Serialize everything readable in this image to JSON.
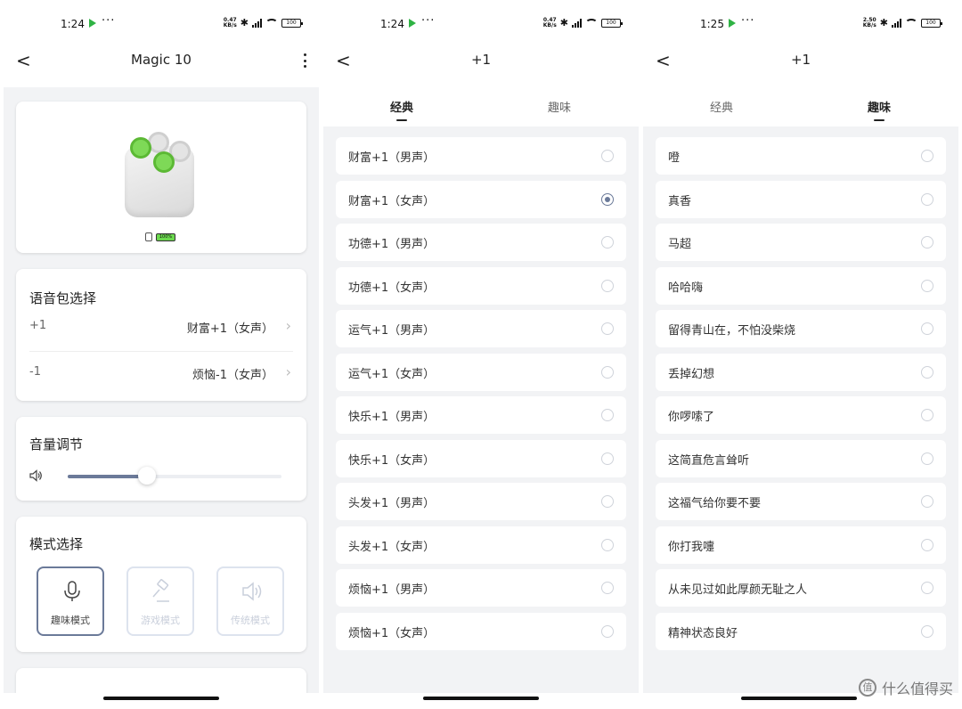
{
  "screen1": {
    "status": {
      "time": "1:24",
      "kbs_top": "0.47",
      "kbs_bottom": "KB/s",
      "battery": "100"
    },
    "nav": {
      "back": "<",
      "title": "Magic 10"
    },
    "device": {
      "battery_pct": "100%"
    },
    "voice_pack": {
      "title": "语音包选择",
      "rows": [
        {
          "key": "+1",
          "value": "财富+1（女声）"
        },
        {
          "key": "-1",
          "value": "烦恼-1（女声）"
        }
      ]
    },
    "volume": {
      "title": "音量调节",
      "level": 0.37
    },
    "mode": {
      "title": "模式选择",
      "modes": [
        {
          "label": "趣味模式",
          "active": true
        },
        {
          "label": "游戏模式",
          "active": false
        },
        {
          "label": "传统模式",
          "active": false
        }
      ]
    }
  },
  "screen2": {
    "status": {
      "time": "1:24",
      "kbs_top": "0.47",
      "kbs_bottom": "KB/s",
      "battery": "100"
    },
    "nav": {
      "back": "<",
      "title": "+1"
    },
    "tabs": [
      "经典",
      "趣味"
    ],
    "active_tab": 0,
    "items": [
      {
        "label": "财富+1（男声）",
        "selected": false
      },
      {
        "label": "财富+1（女声）",
        "selected": true
      },
      {
        "label": "功德+1（男声）",
        "selected": false
      },
      {
        "label": "功德+1（女声）",
        "selected": false
      },
      {
        "label": "运气+1（男声）",
        "selected": false
      },
      {
        "label": "运气+1（女声）",
        "selected": false
      },
      {
        "label": "快乐+1（男声）",
        "selected": false
      },
      {
        "label": "快乐+1（女声）",
        "selected": false
      },
      {
        "label": "头发+1（男声）",
        "selected": false
      },
      {
        "label": "头发+1（女声）",
        "selected": false
      },
      {
        "label": "烦恼+1（男声）",
        "selected": false
      },
      {
        "label": "烦恼+1（女声）",
        "selected": false
      }
    ]
  },
  "screen3": {
    "status": {
      "time": "1:25",
      "kbs_top": "2.50",
      "kbs_bottom": "KB/s",
      "battery": "100"
    },
    "nav": {
      "back": "<",
      "title": "+1"
    },
    "tabs": [
      "经典",
      "趣味"
    ],
    "active_tab": 1,
    "items": [
      {
        "label": "噔",
        "selected": false
      },
      {
        "label": "真香",
        "selected": false
      },
      {
        "label": "马超",
        "selected": false
      },
      {
        "label": "哈哈嗨",
        "selected": false
      },
      {
        "label": "留得青山在，不怕没柴烧",
        "selected": false
      },
      {
        "label": "丢掉幻想",
        "selected": false
      },
      {
        "label": "你啰嗦了",
        "selected": false
      },
      {
        "label": "这简直危言耸听",
        "selected": false
      },
      {
        "label": "这福气给你要不要",
        "selected": false
      },
      {
        "label": "你打我嚏",
        "selected": false
      },
      {
        "label": "从未见过如此厚颜无耻之人",
        "selected": false
      },
      {
        "label": "精神状态良好",
        "selected": false
      }
    ]
  },
  "watermark": {
    "text": "什么值得买",
    "icon_text": "值"
  },
  "colors": {
    "accent": "#6b7a99",
    "green": "#7ed957",
    "page_bg": "#f2f3f5"
  }
}
